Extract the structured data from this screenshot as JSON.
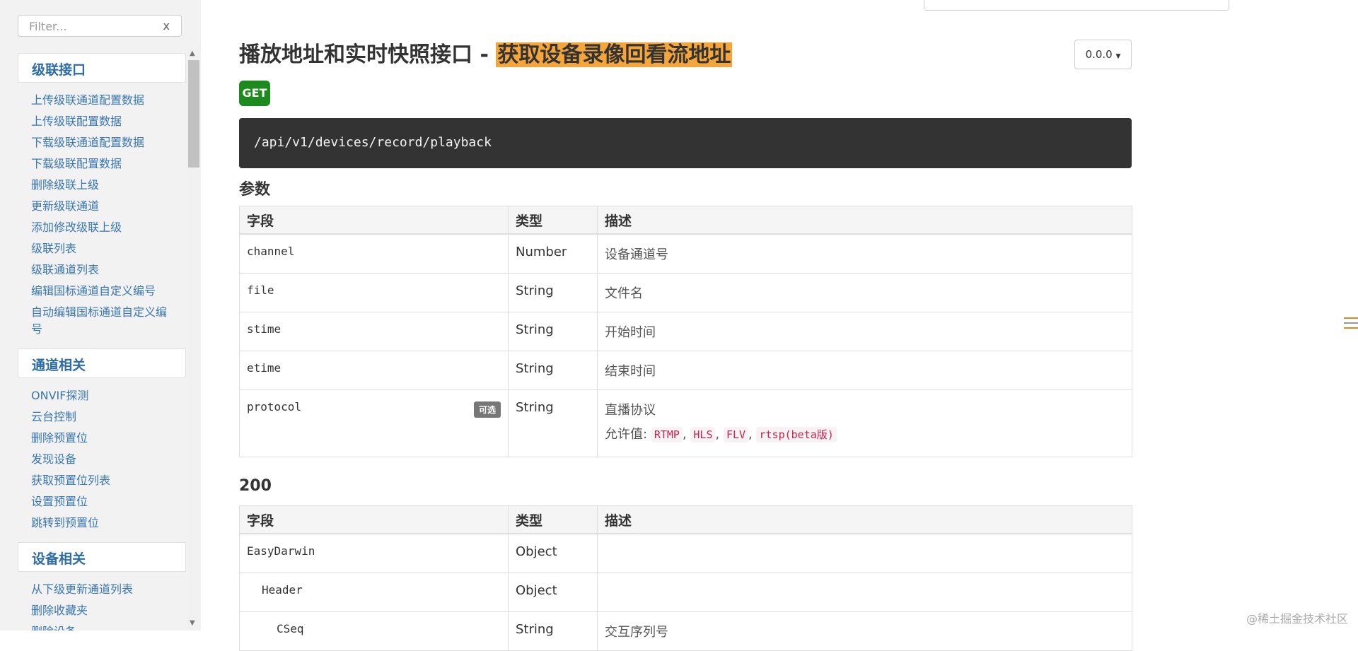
{
  "sidebar": {
    "filter_placeholder": "Filter...",
    "filter_clear": "x",
    "groups": [
      {
        "title": "级联接口",
        "items": [
          "上传级联通道配置数据",
          "上传级联配置数据",
          "下载级联通道配置数据",
          "下载级联配置数据",
          "删除级联上级",
          "更新级联通道",
          "添加修改级联上级",
          "级联列表",
          "级联通道列表",
          "编辑国标通道自定义编号",
          "自动编辑国标通道自定义编号"
        ]
      },
      {
        "title": "通道相关",
        "items": [
          "ONVIF探测",
          "云台控制",
          "删除预置位",
          "发现设备",
          "获取预置位列表",
          "设置预置位",
          "跳转到预置位"
        ]
      },
      {
        "title": "设备相关",
        "items": [
          "从下级更新通道列表",
          "删除收藏夹",
          "删除设备"
        ]
      }
    ]
  },
  "main": {
    "title_prefix": "播放地址和实时快照接口 - ",
    "title_highlight": "获取设备录像回看流地址",
    "version": "0.0.0",
    "method": "GET",
    "endpoint": "/api/v1/devices/record/playback",
    "params_title": "参数",
    "columns": [
      "字段",
      "类型",
      "描述"
    ],
    "params": [
      {
        "field": "channel",
        "type": "Number",
        "desc": "设备通道号"
      },
      {
        "field": "file",
        "type": "String",
        "desc": "文件名"
      },
      {
        "field": "stime",
        "type": "String",
        "desc": "开始时间"
      },
      {
        "field": "etime",
        "type": "String",
        "desc": "结束时间"
      },
      {
        "field": "protocol",
        "optional": "可选",
        "type": "String",
        "desc": "直播协议",
        "allowed_label": "允许值:",
        "allowed": [
          "RTMP",
          "HLS",
          "FLV",
          "rtsp(beta版)"
        ]
      }
    ],
    "response_title": "200",
    "response_rows": [
      {
        "field": "EasyDarwin",
        "type": "Object",
        "desc": ""
      },
      {
        "field": "Header",
        "type": "Object",
        "desc": ""
      },
      {
        "field": "CSeq",
        "type": "String",
        "desc": "交互序列号"
      }
    ]
  },
  "watermark": "@稀土掘金技术社区"
}
